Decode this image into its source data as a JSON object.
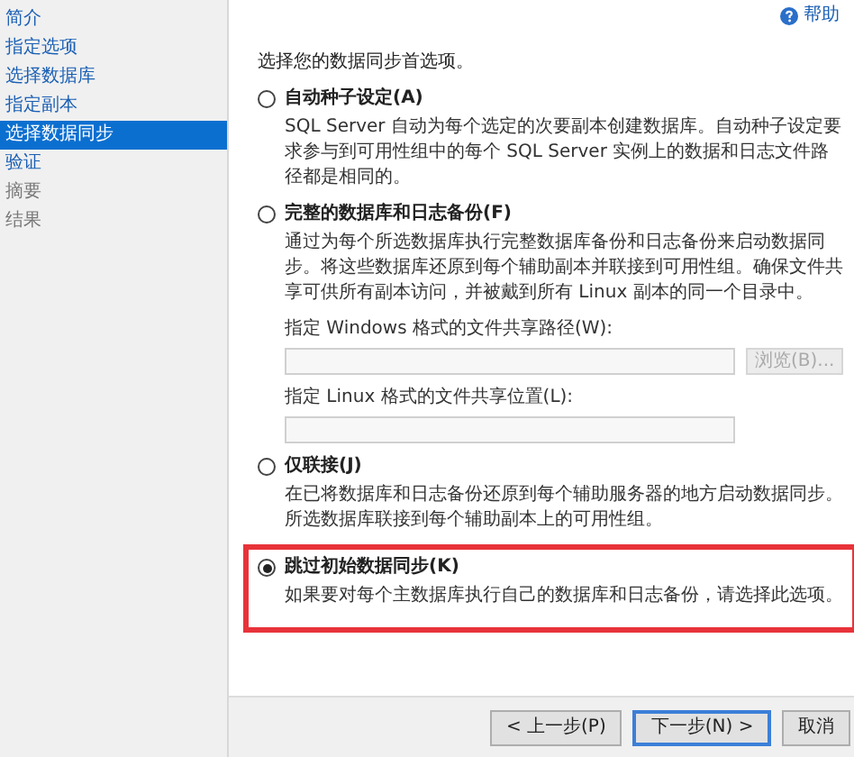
{
  "sidebar": {
    "items": [
      {
        "label": "简介",
        "selected": false,
        "disabled": false
      },
      {
        "label": "指定选项",
        "selected": false,
        "disabled": false
      },
      {
        "label": "选择数据库",
        "selected": false,
        "disabled": false
      },
      {
        "label": "指定副本",
        "selected": false,
        "disabled": false
      },
      {
        "label": "选择数据同步",
        "selected": true,
        "disabled": false
      },
      {
        "label": "验证",
        "selected": false,
        "disabled": false
      },
      {
        "label": "摘要",
        "selected": false,
        "disabled": true
      },
      {
        "label": "结果",
        "selected": false,
        "disabled": true
      }
    ]
  },
  "help": {
    "label": "帮助"
  },
  "heading": "选择您的数据同步首选项。",
  "options": [
    {
      "label": "自动种子设定(A)",
      "selected": false,
      "highlighted": false,
      "description": "SQL Server 自动为每个选定的次要副本创建数据库。自动种子设定要求参与到可用性组中的每个 SQL Server 实例上的数据和日志文件路径都是相同的。"
    },
    {
      "label": "完整的数据库和日志备份(F)",
      "selected": false,
      "highlighted": false,
      "description": "通过为每个所选数据库执行完整数据库备份和日志备份来启动数据同步。将这些数据库还原到每个辅助副本并联接到可用性组。确保文件共享可供所有副本访问，并被戴到所有 Linux 副本的同一个目录中。",
      "fields": [
        {
          "label": "指定 Windows 格式的文件共享路径(W):",
          "button": {
            "label": "浏览(B)...",
            "disabled": true
          }
        },
        {
          "label": "指定 Linux 格式的文件共享位置(L):"
        }
      ]
    },
    {
      "label": "仅联接(J)",
      "selected": false,
      "highlighted": false,
      "description": "在已将数据库和日志备份还原到每个辅助服务器的地方启动数据同步。所选数据库联接到每个辅助副本上的可用性组。"
    },
    {
      "label": "跳过初始数据同步(K)",
      "selected": true,
      "highlighted": true,
      "description": "如果要对每个主数据库执行自己的数据库和日志备份，请选择此选项。"
    }
  ],
  "buttons": [
    {
      "label": "< 上一步(P)",
      "default": false
    },
    {
      "label": "下一步(N) >",
      "default": true
    },
    {
      "label": "取消",
      "default": false
    }
  ]
}
